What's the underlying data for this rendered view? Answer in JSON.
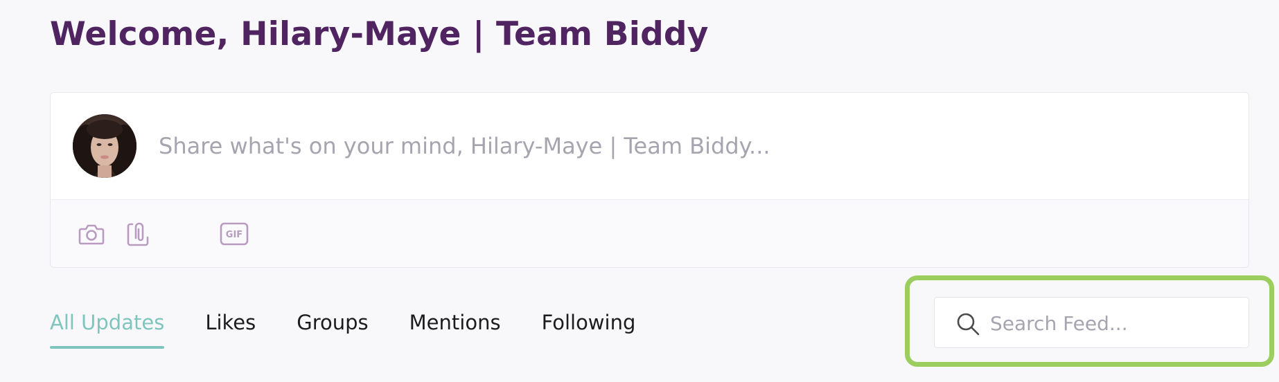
{
  "header": {
    "title": "Welcome, Hilary-Maye | Team Biddy"
  },
  "composer": {
    "placeholder": "Share what's on your mind, Hilary-Maye | Team Biddy...",
    "tools": [
      {
        "icon": "camera-icon"
      },
      {
        "icon": "attachment-icon"
      },
      {
        "icon": "gif-icon",
        "label": "GIF"
      }
    ]
  },
  "tabs": [
    {
      "label": "All Updates",
      "active": true
    },
    {
      "label": "Likes",
      "active": false
    },
    {
      "label": "Groups",
      "active": false
    },
    {
      "label": "Mentions",
      "active": false
    },
    {
      "label": "Following",
      "active": false
    }
  ],
  "search": {
    "placeholder": "Search Feed...",
    "icon": "search-icon"
  },
  "colors": {
    "title": "#4f2460",
    "active_tab": "#7fc5bd",
    "tool_icon": "#b89bbf",
    "highlight": "#9ccd5f"
  }
}
